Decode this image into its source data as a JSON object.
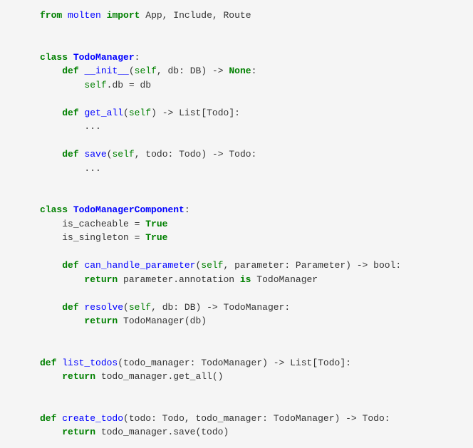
{
  "code": {
    "l1": {
      "from": "from",
      "mod": "molten",
      "import": "import",
      "names": "App, Include, Route"
    },
    "l2": {
      "class": "class",
      "name": "TodoManager",
      "colon": ":"
    },
    "l3": {
      "def": "def",
      "name": "__init__",
      "lparen": "(",
      "self": "self",
      "comma": ", ",
      "param": "db: DB",
      "rparen": ")",
      "arrow": " -> ",
      "ret": "None",
      "colon": ":"
    },
    "l4": {
      "self": "self",
      "rest": ".db = db"
    },
    "l5": {
      "def": "def",
      "name": "get_all",
      "lparen": "(",
      "self": "self",
      "rparen": ")",
      "arrow": " -> ",
      "ret": "List[Todo]:"
    },
    "l6": {
      "dots": "..."
    },
    "l7": {
      "def": "def",
      "name": "save",
      "lparen": "(",
      "self": "self",
      "comma": ", ",
      "param": "todo: Todo",
      "rparen": ")",
      "arrow": " -> ",
      "ret": "Todo:"
    },
    "l8": {
      "dots": "..."
    },
    "l9": {
      "class": "class",
      "name": "TodoManagerComponent",
      "colon": ":"
    },
    "l10": {
      "attr": "is_cacheable = ",
      "val": "True"
    },
    "l11": {
      "attr": "is_singleton = ",
      "val": "True"
    },
    "l12": {
      "def": "def",
      "name": "can_handle_parameter",
      "lparen": "(",
      "self": "self",
      "comma": ", ",
      "param": "parameter: Parameter",
      "rparen": ")",
      "arrow": " -> ",
      "ret": "bool",
      "colon": ":"
    },
    "l13": {
      "return": "return",
      "rest": " parameter.annotation ",
      "is": "is",
      "rest2": " TodoManager"
    },
    "l14": {
      "def": "def",
      "name": "resolve",
      "lparen": "(",
      "self": "self",
      "comma": ", ",
      "param": "db: DB",
      "rparen": ")",
      "arrow": " -> ",
      "ret": "TodoManager:"
    },
    "l15": {
      "return": "return",
      "rest": " TodoManager(db)"
    },
    "l16": {
      "def": "def",
      "name": "list_todos",
      "lparen": "(",
      "param": "todo_manager: TodoManager",
      "rparen": ")",
      "arrow": " -> ",
      "ret": "List[Todo]:"
    },
    "l17": {
      "return": "return",
      "rest": " todo_manager.get_all()"
    },
    "l18": {
      "def": "def",
      "name": "create_todo",
      "lparen": "(",
      "param": "todo: Todo, todo_manager: TodoManager",
      "rparen": ")",
      "arrow": " -> ",
      "ret": "Todo:"
    },
    "l19": {
      "return": "return",
      "rest": " todo_manager.save(todo)"
    }
  }
}
